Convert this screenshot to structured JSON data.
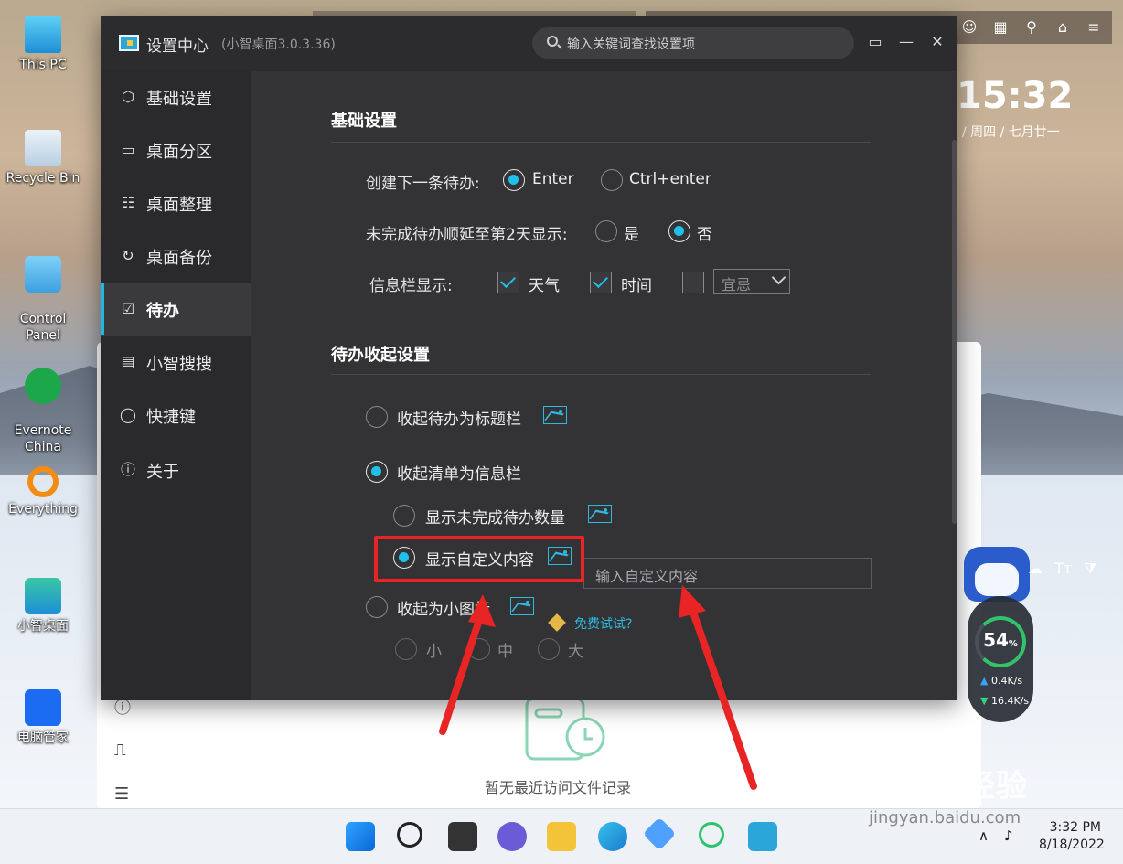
{
  "desktop": {
    "icons": [
      {
        "label": "This PC"
      },
      {
        "label": "Recycle Bin"
      },
      {
        "label": "Control\nPanel"
      },
      {
        "label": "Evernote\nChina"
      },
      {
        "label": "Everything"
      },
      {
        "label": "小智桌面"
      },
      {
        "label": "电脑管家"
      }
    ]
  },
  "widget": {
    "clock": "15:32",
    "date": "/ 周四 / 七月廿一"
  },
  "background_window": {
    "empty_text": "暂无最近访问文件记录"
  },
  "window": {
    "title": "设置中心",
    "version": "(小智桌面3.0.3.36)",
    "search_placeholder": "输入关键词查找设置项",
    "colors": {
      "accent": "#1fc1ea",
      "bg": "#2f2f31",
      "highlight": "#e82424"
    }
  },
  "sidebar": {
    "items": [
      {
        "label": "基础设置",
        "icon": "hexagon-icon"
      },
      {
        "label": "桌面分区",
        "icon": "monitor-icon"
      },
      {
        "label": "桌面整理",
        "icon": "grid-list-icon"
      },
      {
        "label": "桌面备份",
        "icon": "backup-icon"
      },
      {
        "label": "待办",
        "icon": "calendar-check-icon"
      },
      {
        "label": "小智搜搜",
        "icon": "browser-icon"
      },
      {
        "label": "快捷键",
        "icon": "mouse-icon"
      },
      {
        "label": "关于",
        "icon": "info-icon"
      }
    ],
    "active": "待办"
  },
  "basic": {
    "title": "基础设置",
    "create_label": "创建下一条待办:",
    "create_opt1": "Enter",
    "create_opt2": "Ctrl+enter",
    "postpone_label": "未完成待办顺延至第2天显示:",
    "postpone_yes": "是",
    "postpone_no": "否",
    "infobar_label": "信息栏显示:",
    "weather": "天气",
    "time": "时间",
    "select_value": "宜忌"
  },
  "collapse": {
    "title": "待办收起设置",
    "opt_titlebar": "收起待办为标题栏",
    "opt_infobar": "收起清单为信息栏",
    "sub_count": "显示未完成待办数量",
    "sub_custom": "显示自定义内容",
    "custom_placeholder": "输入自定义内容",
    "opt_icon": "收起为小图标",
    "free_trial": "免费试试?",
    "size_small": "小",
    "size_medium": "中",
    "size_large": "大"
  },
  "perf": {
    "percent": "54",
    "unit": "%",
    "up": "0.4K/s",
    "down": "16.4K/s"
  },
  "taskbar": {
    "time": "3:32 PM",
    "date": "8/18/2022"
  },
  "watermark": {
    "main": "Baidu经验",
    "sub": "jingyan.baidu.com"
  }
}
